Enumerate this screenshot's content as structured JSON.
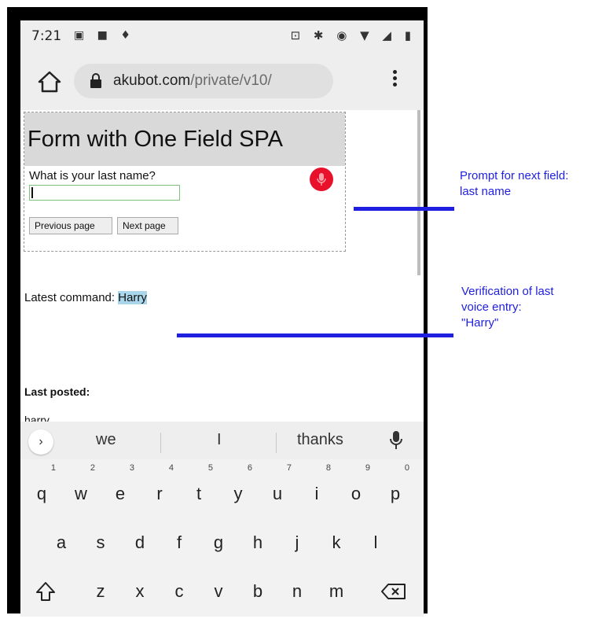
{
  "status_bar": {
    "time": "7:21"
  },
  "browser": {
    "url_domain": "akubot.com",
    "url_path": "/private/v10/"
  },
  "page": {
    "form_title": "Form with One Field SPA",
    "question": "What is your last name?",
    "answer_value": "",
    "prev_button": "Previous page",
    "next_button": "Next page",
    "latest_label": "Latest command: ",
    "latest_value": "Harry",
    "posted_label": "Last posted:",
    "posted_value": "harry"
  },
  "keyboard": {
    "suggestions": [
      "we",
      "I",
      "thanks"
    ],
    "row1": [
      "q",
      "w",
      "e",
      "r",
      "t",
      "y",
      "u",
      "i",
      "o",
      "p"
    ],
    "row1_hints": [
      "1",
      "2",
      "3",
      "4",
      "5",
      "6",
      "7",
      "8",
      "9",
      "0"
    ],
    "row2": [
      "a",
      "s",
      "d",
      "f",
      "g",
      "h",
      "j",
      "k",
      "l"
    ],
    "row3": [
      "z",
      "x",
      "c",
      "v",
      "b",
      "n",
      "m"
    ]
  },
  "annotations": {
    "prompt_line1": "Prompt for next field:",
    "prompt_line2": "last name",
    "verify_line1": "Verification of last",
    "verify_line2": "voice entry:",
    "verify_line3": "\"Harry\""
  },
  "colors": {
    "annotation": "#1f1fe0",
    "mic": "#e8102a",
    "highlight": "#a9d6ea"
  }
}
